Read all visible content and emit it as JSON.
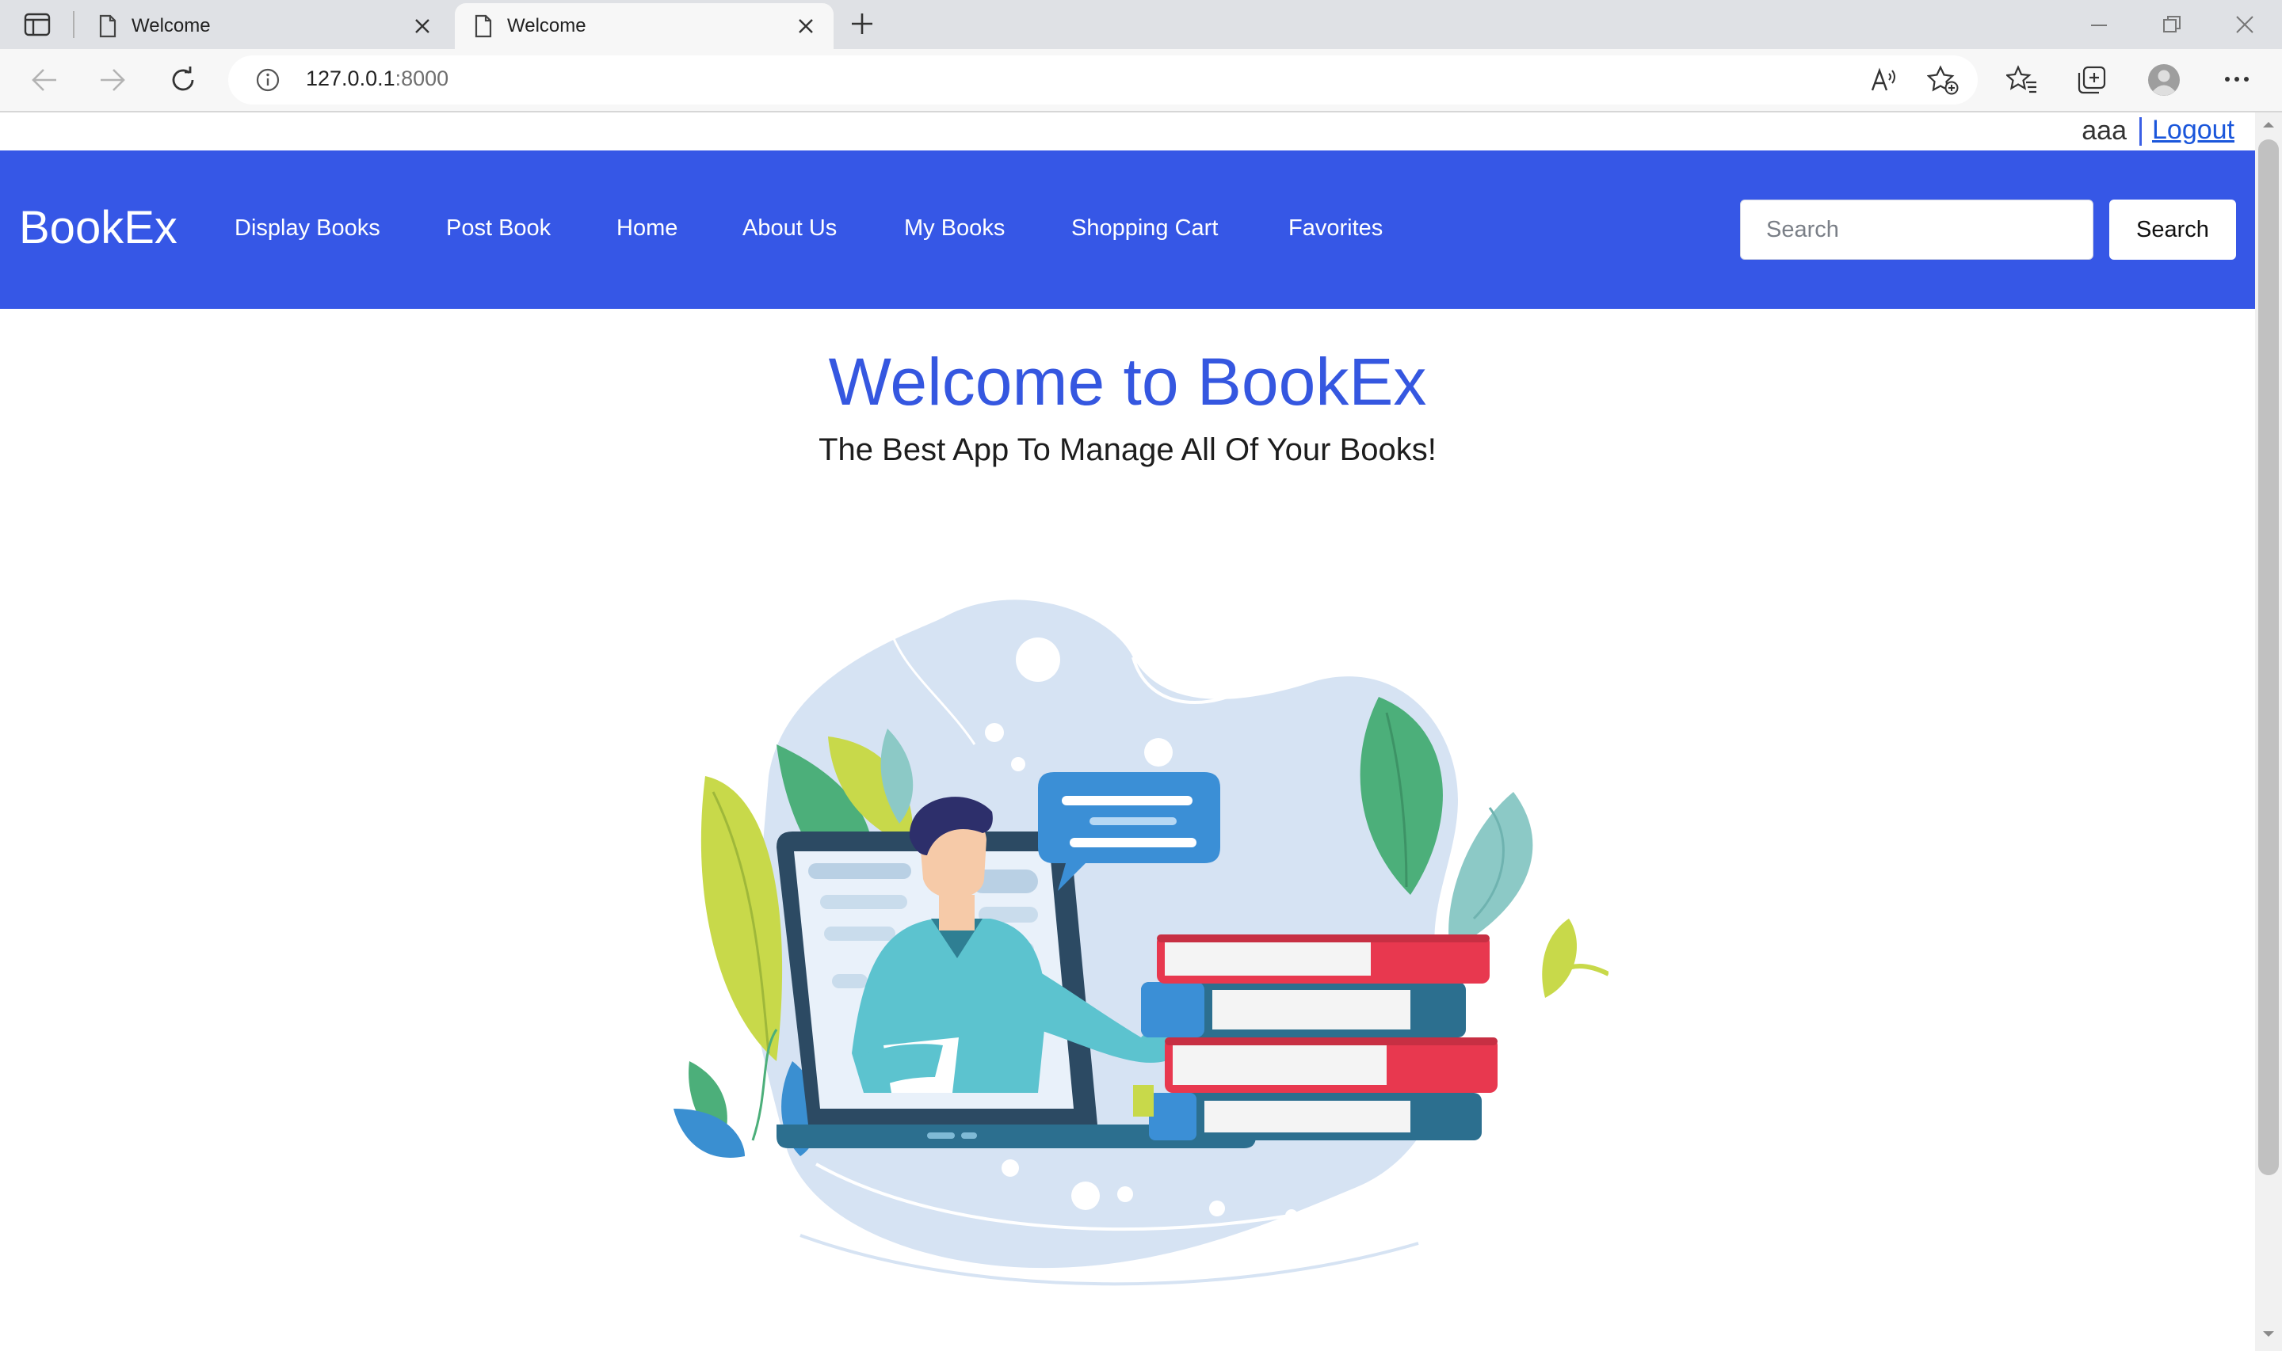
{
  "browser": {
    "tabs": [
      {
        "title": "Welcome",
        "active": false
      },
      {
        "title": "Welcome",
        "active": true
      }
    ],
    "url_host": "127.0.0.1",
    "url_port": ":8000"
  },
  "user": {
    "username": "aaa",
    "logout_label": "Logout"
  },
  "navbar": {
    "brand": "BookEx",
    "links": [
      "Display Books",
      "Post Book",
      "Home",
      "About Us",
      "My Books",
      "Shopping Cart",
      "Favorites"
    ],
    "search_placeholder": "Search",
    "search_button": "Search"
  },
  "hero": {
    "title": "Welcome to BookEx",
    "subtitle": "The Best App To Manage All Of Your Books!"
  },
  "colors": {
    "navbar": "#3657e6",
    "title": "#3557e0",
    "link": "#1a56db"
  },
  "icons": [
    "tab-actions-icon",
    "page-icon",
    "close-icon",
    "new-tab-icon",
    "back-icon",
    "forward-icon",
    "refresh-icon",
    "info-icon",
    "read-aloud-icon",
    "add-favorite-icon",
    "favorites-icon",
    "collections-icon",
    "profile-icon",
    "more-icon",
    "minimize-icon",
    "restore-icon"
  ]
}
